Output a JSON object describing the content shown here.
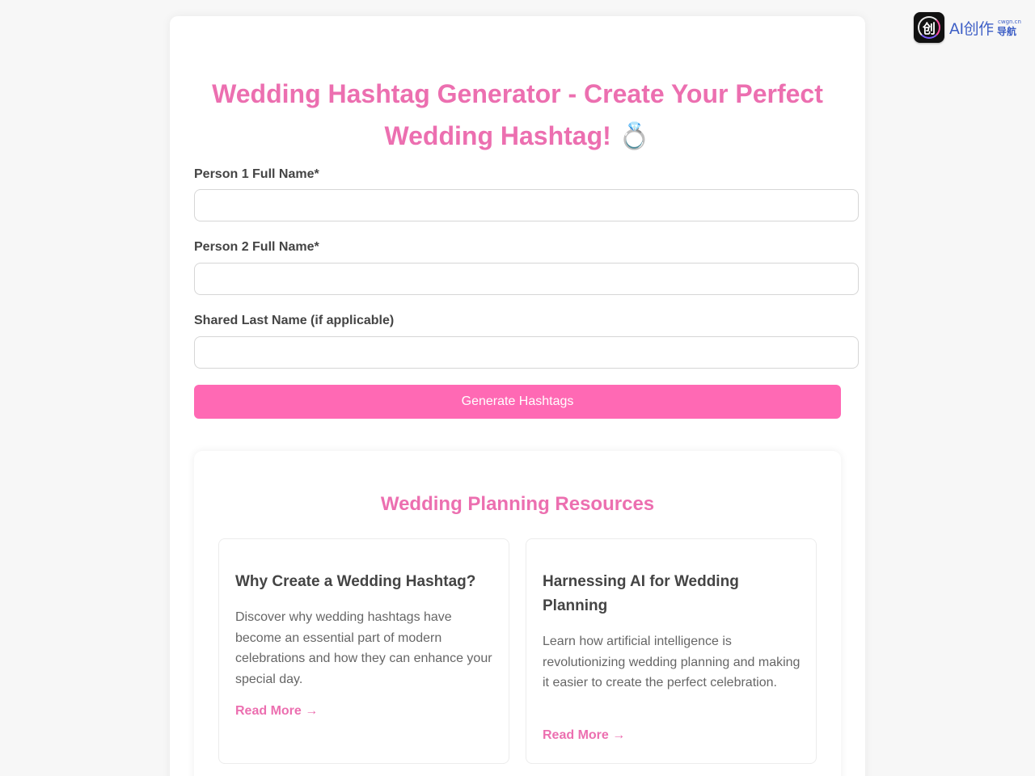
{
  "brand": {
    "logo_glyph": "创",
    "text_main": "AI创作",
    "text_small": "cwgn.cn",
    "text_nav": "导航"
  },
  "header": {
    "title": "Wedding Hashtag Generator - Create Your Perfect Wedding Hashtag!",
    "title_emoji": "💍"
  },
  "form": {
    "person1_label": "Person 1 Full Name*",
    "person1_value": "",
    "person2_label": "Person 2 Full Name*",
    "person2_value": "",
    "lastname_label": "Shared Last Name (if applicable)",
    "lastname_value": "",
    "generate_label": "Generate Hashtags"
  },
  "resources": {
    "title": "Wedding Planning Resources",
    "cards": [
      {
        "title": "Why Create a Wedding Hashtag?",
        "text": "Discover why wedding hashtags have become an essential part of modern celebrations and how they can enhance your special day.",
        "link": "Read More →"
      },
      {
        "title": "Harnessing AI for Wedding Planning",
        "text": "Learn how artificial intelligence is revolutionizing wedding planning and making it easier to create the perfect celebration.",
        "link": "Read More →"
      }
    ]
  },
  "colors": {
    "accent": "#ec6fb0",
    "button": "#ff69b4",
    "brand_blue": "#3e5fc6"
  }
}
